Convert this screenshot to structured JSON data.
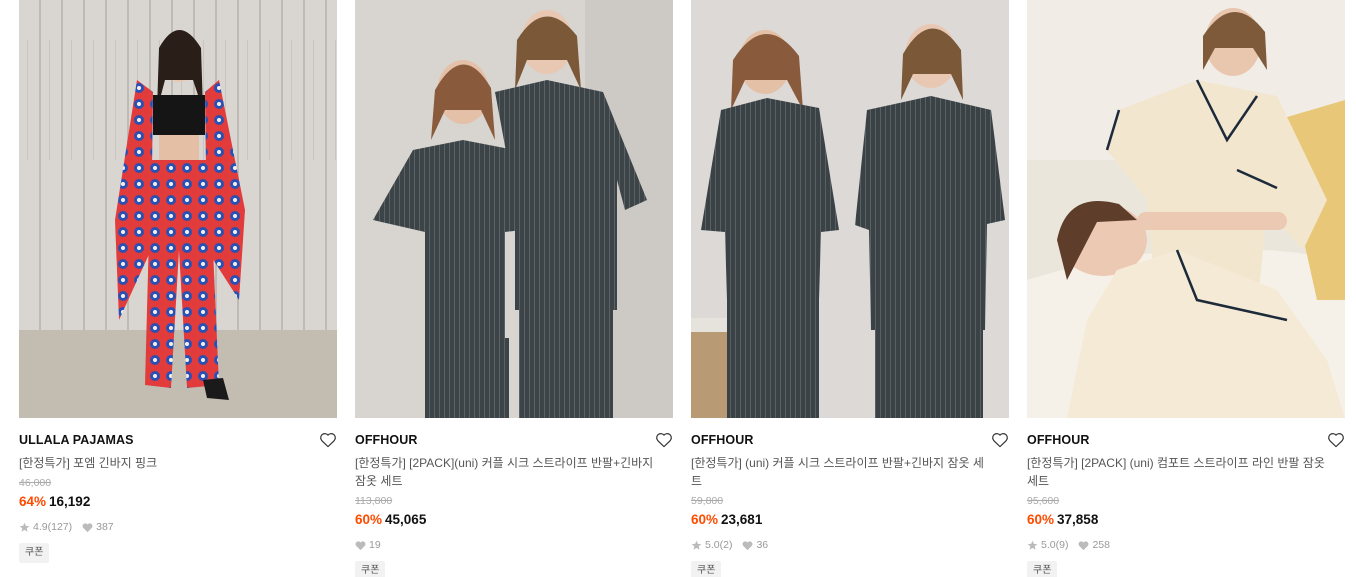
{
  "products": [
    {
      "brand": "ULLALA PAJAMAS",
      "title": "[한정특가] 포엠 긴바지 핑크",
      "original_price": "46,000",
      "discount": "64%",
      "price": "16,192",
      "rating": "4.9",
      "reviews": "(127)",
      "likes": "387",
      "badge": "쿠폰",
      "image_desc": "woman in red and blue patterned robe and pants"
    },
    {
      "brand": "OFFHOUR",
      "title": "[한정특가] [2PACK](uni) 커플 시크 스트라이프 반팔+긴바지 잠옷 세트",
      "original_price": "113,800",
      "discount": "60%",
      "price": "45,065",
      "rating": "",
      "reviews": "",
      "likes": "19",
      "badge": "쿠폰",
      "image_desc": "couple in dark striped short sleeve pajamas"
    },
    {
      "brand": "OFFHOUR",
      "title": "[한정특가] (uni) 커플 시크 스트라이프 반팔+긴바지 잠옷 세트",
      "original_price": "59,800",
      "discount": "60%",
      "price": "23,681",
      "rating": "5.0",
      "reviews": "(2)",
      "likes": "36",
      "badge": "쿠폰",
      "image_desc": "couple in dark striped pajamas standing"
    },
    {
      "brand": "OFFHOUR",
      "title": "[한정특가] [2PACK] (uni) 컴포트 스트라이프 라인 반팔 잠옷 세트",
      "original_price": "95,600",
      "discount": "60%",
      "price": "37,858",
      "rating": "5.0",
      "reviews": "(9)",
      "likes": "258",
      "badge": "쿠폰",
      "image_desc": "couple in cream pajamas lying in bed"
    }
  ],
  "colors": {
    "discount": "#ff4b00",
    "brand_text": "#111111",
    "meta_text": "#999999",
    "badge_bg": "#f2f2f2"
  }
}
